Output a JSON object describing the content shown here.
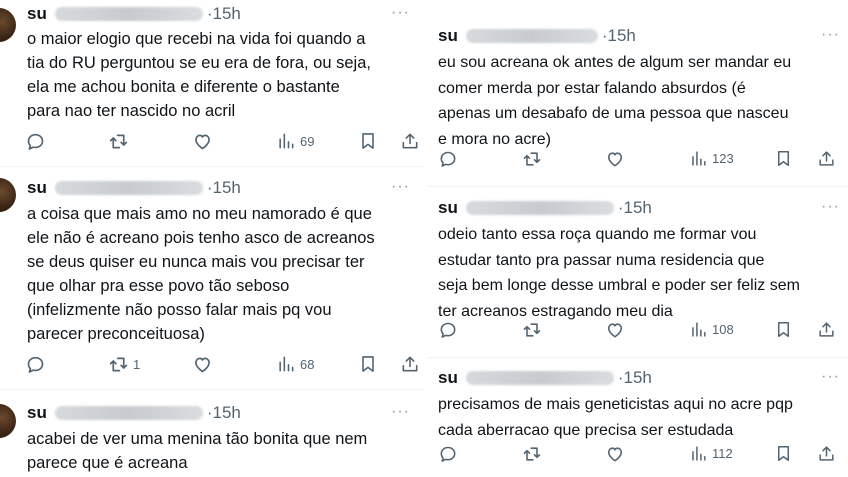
{
  "ui": {
    "more_glyph": "···"
  },
  "icons": [
    "reply-icon",
    "retweet-icon",
    "like-icon",
    "views-icon",
    "bookmark-icon",
    "share-icon",
    "more-icon"
  ],
  "colors": {
    "text": "#0f1419",
    "muted": "#536471",
    "separator": "#eff3f4"
  },
  "left_column": [
    {
      "name": "su",
      "time": "15h",
      "text": "o maior elogio que recebi na vida foi quando a\ntia do RU perguntou se eu era de fora, ou seja,\nela me achou bonita e diferente o bastante\npara nao ter nascido no acril",
      "retweets": "",
      "views": "69"
    },
    {
      "name": "su",
      "time": "15h",
      "text": "a coisa que mais amo no meu namorado é que\nele não é acreano pois tenho asco de acreanos\nse deus quiser eu nunca mais vou precisar ter\nque olhar pra esse povo tão seboso\n(infelizmente não posso falar mais pq vou\nparecer preconceituosa)",
      "retweets": "1",
      "views": "68"
    },
    {
      "name": "su",
      "time": "15h",
      "text": "acabei de ver uma menina tão bonita que nem\nparece que é acreana",
      "retweets": "",
      "views": ""
    }
  ],
  "right_column": [
    {
      "name": "su",
      "time": "15h",
      "text": "eu sou acreana ok antes de algum ser mandar eu\ncomer merda por estar falando absurdos (é\napenas um desabafo de uma pessoa que nasceu\ne mora no acre)",
      "retweets": "",
      "views": "123"
    },
    {
      "name": "su",
      "time": "15h",
      "text": "odeio tanto essa roça quando me formar vou\nestudar tanto pra passar numa residencia que\nseja bem longe desse umbral e poder ser feliz sem\nter acreanos estragando meu dia",
      "retweets": "",
      "views": "108"
    },
    {
      "name": "su",
      "time": "15h",
      "text": "precisamos de mais geneticistas aqui no acre pqp\ncada aberracao que precisa ser estudada",
      "retweets": "",
      "views": "112"
    }
  ]
}
